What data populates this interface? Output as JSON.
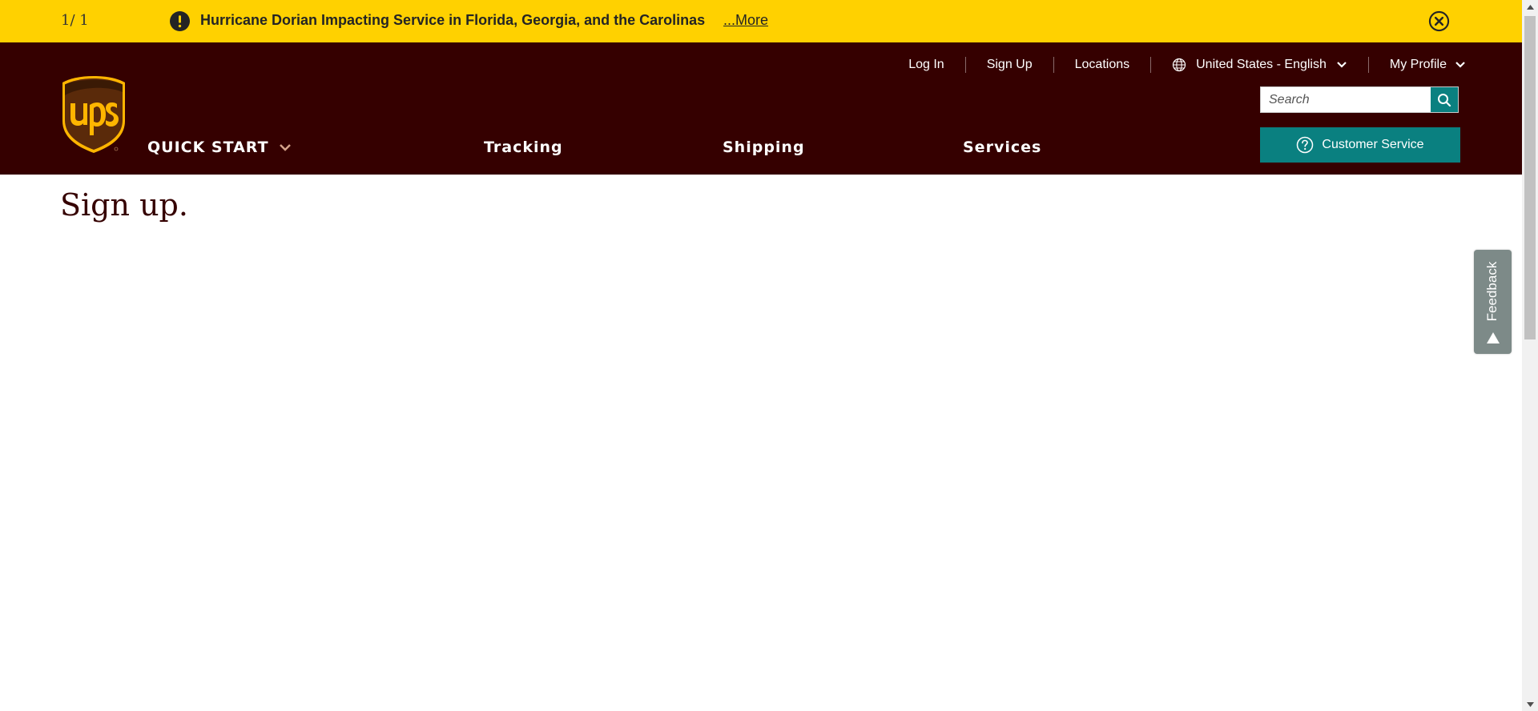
{
  "alert": {
    "counter": "1/ 1",
    "message": "Hurricane Dorian Impacting Service in Florida, Georgia, and the Carolinas",
    "more_link": "...More",
    "icon": "exclamation-circle-icon",
    "close_icon": "close-circle-icon"
  },
  "header": {
    "logo": "ups",
    "utility_nav": {
      "login": "Log In",
      "signup": "Sign Up",
      "locations": "Locations",
      "language": "United States - English",
      "my_profile": "My Profile"
    },
    "search": {
      "placeholder": "Search"
    },
    "customer_service": "Customer Service",
    "main_nav": {
      "quick_start": "QUICK START",
      "tracking": "Tracking",
      "shipping": "Shipping",
      "services": "Services"
    }
  },
  "main": {
    "title": "Sign up."
  },
  "feedback": {
    "label": "Feedback"
  },
  "colors": {
    "alert_bg": "#ffd100",
    "header_bg": "#350000",
    "teal": "#0a8080",
    "logo_gold": "#ffb500",
    "feedback_bg": "#7d8a88"
  }
}
